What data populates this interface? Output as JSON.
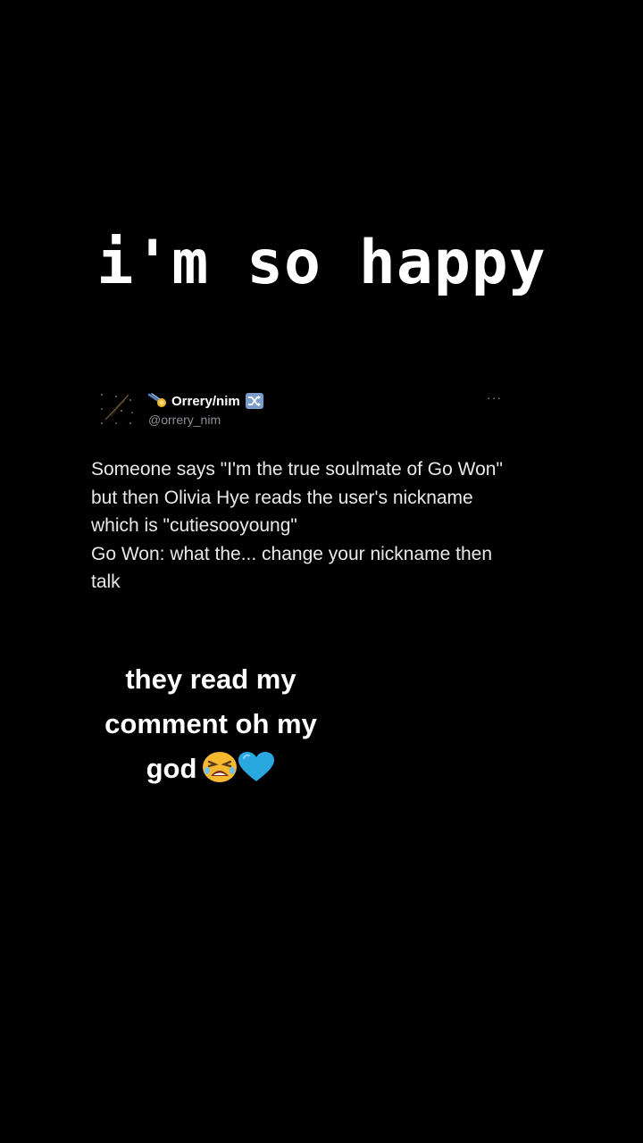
{
  "headline": "i'm so happy",
  "tweet": {
    "display_name": "Orrery/nim",
    "handle": "@orrery_nim",
    "name_prefix_icon": "comet-emoji-icon",
    "name_suffix_icon": "shuffle-emoji-icon",
    "more_icon": "more-options-icon",
    "more_label": "···",
    "body": "Someone says \"I'm the true soulmate of Go Won\" but then Olivia Hye reads the user's nickname which is \"cutiesooyoung\"\nGo Won: what the... change your nickname then talk"
  },
  "caption": {
    "line1": "they read my",
    "line2": "comment oh my",
    "line3": "god",
    "emojis": [
      "tired-face-emoji-icon",
      "blue-heart-emoji-icon"
    ]
  },
  "colors": {
    "background": "#000000",
    "text": "#ffffff",
    "secondary": "#8b8f93",
    "heart": "#29a8e0",
    "emoji_face": "#f5b82e"
  }
}
